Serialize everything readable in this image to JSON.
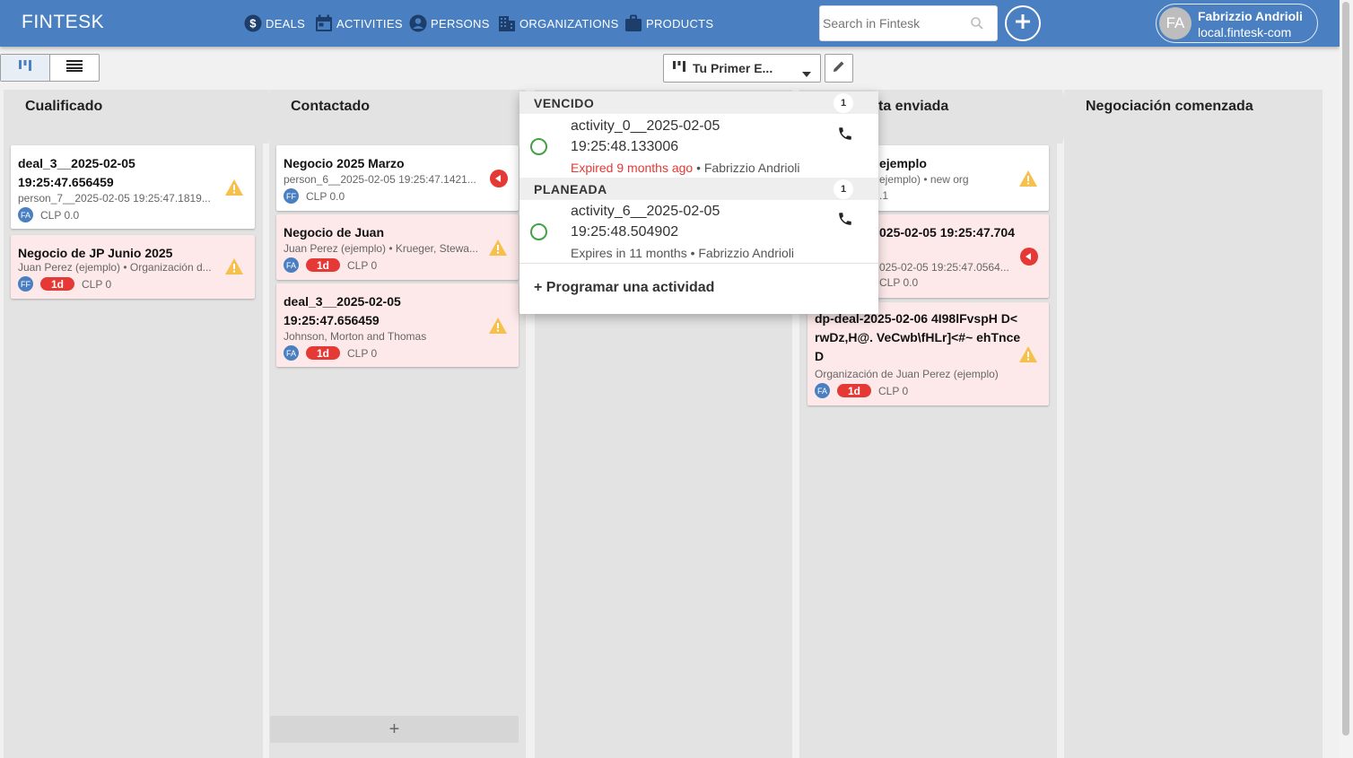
{
  "app": {
    "brand": "FINTESK",
    "nav": [
      {
        "label": "DEALS",
        "icon": "dollar-icon"
      },
      {
        "label": "ACTIVITIES",
        "icon": "calendar-icon"
      },
      {
        "label": "PERSONS",
        "icon": "person-icon"
      },
      {
        "label": "ORGANIZATIONS",
        "icon": "building-icon"
      },
      {
        "label": "PRODUCTS",
        "icon": "briefcase-icon"
      }
    ],
    "search": {
      "placeholder": "Search in Fintesk",
      "value": ""
    },
    "user": {
      "initials": "FA",
      "name": "Fabrizzio Andrioli",
      "org": "local.fintesk-com"
    }
  },
  "toolbar": {
    "pipeline_label": "Tu Primer E...",
    "view_active": "kanban"
  },
  "stages": [
    {
      "title": "Cualificado"
    },
    {
      "title": "Contactado"
    },
    {
      "title": ""
    },
    {
      "title": "ta enviada"
    },
    {
      "title": "Negociación comenzada"
    }
  ],
  "deals": {
    "c1": [
      {
        "title": "deal_3__2025-02-05 19:25:47.656459",
        "sub": "person_7__2025-02-05 19:25:47.1819...",
        "avatar": "FA",
        "badge": "",
        "amount": "CLP 0.0"
      },
      {
        "title": "Negocio de JP Junio 2025",
        "sub": "Juan Perez (ejemplo) • Organización d...",
        "avatar": "FF",
        "badge": "1d",
        "amount": "CLP 0"
      }
    ],
    "c2": [
      {
        "title": "Negocio 2025 Marzo",
        "sub": "person_6__2025-02-05 19:25:47.1421...",
        "avatar": "FF",
        "badge": "",
        "amount": "CLP 0.0"
      },
      {
        "title": "Negocio de Juan",
        "sub": "Juan Perez (ejemplo) • Krueger, Stewa...",
        "avatar": "FA",
        "badge": "1d",
        "amount": "CLP 0"
      },
      {
        "title": "deal_3__2025-02-05 19:25:47.656459",
        "sub": "Johnson, Morton and Thomas",
        "avatar": "FA",
        "badge": "1d",
        "amount": "CLP 0"
      }
    ],
    "c4": [
      {
        "title": "ejemplo",
        "sub": "ejemplo) • new org",
        "sub2": ".1",
        "avatar": "",
        "badge": "",
        "amount": ""
      },
      {
        "title": "025-02-05 19:25:47.704",
        "sub": "025-02-05 19:25:47.0564...",
        "avatar": "",
        "badge": "",
        "amount": "CLP 0.0"
      },
      {
        "title": "dp-deal-2025-02-06 4I98lFvspH D<rwDz,H@. VeCwb\\fHLr]<#~ ehTnceD",
        "sub": "Organización de Juan Perez (ejemplo)",
        "avatar": "FA",
        "badge": "1d",
        "amount": "CLP 0"
      }
    ]
  },
  "popover": {
    "overdue": {
      "title": "VENCIDO",
      "count": "1",
      "activity": "activity_0__2025-02-05 19:25:48.133006",
      "expired": "Expired 9 months ago",
      "owner": " • Fabrizzio Andrioli"
    },
    "planned": {
      "title": "PLANEADA",
      "count": "1",
      "activity": "activity_6__2025-02-05 19:25:48.504902",
      "meta": "Expires in 11 months • Fabrizzio Andrioli"
    },
    "schedule_label": "+ Programar una actividad"
  },
  "add_deal_label": "+",
  "colors": {
    "topbar": "#4a7fc1",
    "late_card": "#fde9e9",
    "danger": "#e53935",
    "success": "#43a047",
    "warning": "#f5c14c"
  }
}
